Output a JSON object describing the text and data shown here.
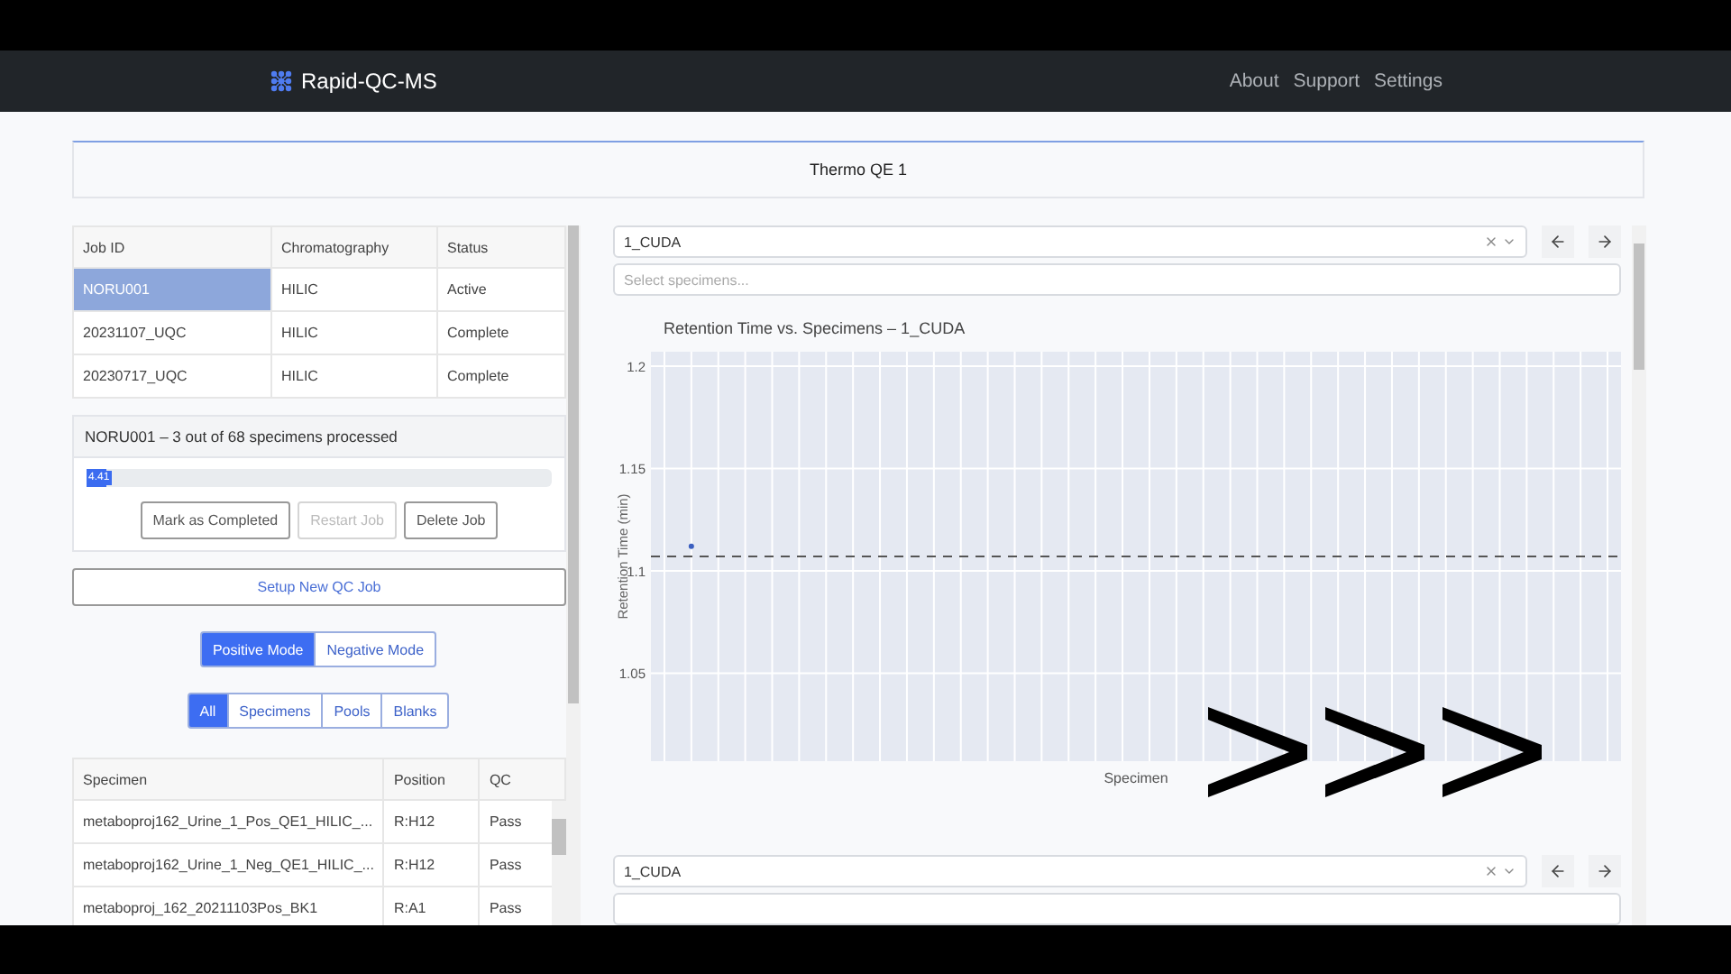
{
  "navbar": {
    "brand": "Rapid-QC-MS",
    "links": [
      "About",
      "Support",
      "Settings"
    ]
  },
  "instrument_card": {
    "title": "Thermo QE 1"
  },
  "jobs_table": {
    "columns": [
      "Job ID",
      "Chromatography",
      "Status"
    ],
    "rows": [
      {
        "cells": [
          "NORU001",
          "HILIC",
          "Active"
        ],
        "selected": true
      },
      {
        "cells": [
          "20231107_UQC",
          "HILIC",
          "Complete"
        ],
        "selected": false
      },
      {
        "cells": [
          "20230717_UQC",
          "HILIC",
          "Complete"
        ],
        "selected": false
      }
    ]
  },
  "job_card": {
    "title": "NORU001 – 3 out of 68 specimens processed",
    "progress": {
      "level": 0.044,
      "label": "4.41"
    },
    "buttons": [
      {
        "label": "Mark as Completed",
        "disabled": false
      },
      {
        "label": "Restart Job",
        "disabled": true
      },
      {
        "label": "Delete Job",
        "disabled": false
      }
    ]
  },
  "setup_button": "Setup New QC Job",
  "polarity_toggle": [
    {
      "label": "Positive Mode",
      "selected": true
    },
    {
      "label": "Negative Mode",
      "selected": false
    }
  ],
  "sample_filter": [
    {
      "label": "All",
      "selected": true
    },
    {
      "label": "Specimens",
      "selected": false
    },
    {
      "label": "Pools",
      "selected": false
    },
    {
      "label": "Blanks",
      "selected": false
    }
  ],
  "samples_table": {
    "columns": [
      "Specimen",
      "Position",
      "QC"
    ],
    "rows": [
      [
        "metaboproj162_Urine_1_Pos_QE1_HILIC_...",
        "R:H12",
        "Pass"
      ],
      [
        "metaboproj162_Urine_1_Neg_QE1_HILIC_...",
        "R:H12",
        "Pass"
      ],
      [
        "metaboproj_162_20211103Pos_BK1",
        "R:A1",
        "Pass"
      ]
    ]
  },
  "plots": [
    {
      "dropdown": {
        "value": "1_CUDA"
      },
      "specimen_select": {
        "placeholder": "Select specimens..."
      },
      "title": "Retention Time vs. Specimens – 1_CUDA",
      "chart_data": {
        "type": "scatter",
        "xlabel": "Specimen",
        "ylabel": "Retention Time (min)",
        "ylim": [
          1.007,
          1.207
        ],
        "yticks": [
          1.05,
          1.1,
          1.15,
          1.2
        ],
        "categories": [
          null,
          null,
          null,
          null,
          null,
          null,
          null,
          null,
          null,
          null,
          null,
          null,
          null,
          null,
          null,
          null,
          null,
          null,
          null,
          null,
          null,
          null,
          null,
          null,
          null,
          null,
          null,
          null,
          null,
          null,
          null,
          null,
          null,
          null,
          null,
          null
        ],
        "values": [
          null,
          1.112,
          null,
          null,
          null,
          null,
          null,
          null,
          null,
          null,
          null,
          null,
          null,
          null,
          null,
          null,
          null,
          null,
          null,
          null,
          null,
          null,
          null,
          null,
          null,
          null,
          null,
          null,
          null,
          null,
          null,
          null,
          null,
          null,
          null,
          null
        ],
        "grid": true,
        "ref_lines": [
          {
            "axis": "y",
            "value": 1.107
          }
        ]
      },
      "overlay": {
        "kind": "fast_forward"
      }
    },
    {
      "dropdown": {
        "value": "1_CUDA"
      }
    }
  ]
}
